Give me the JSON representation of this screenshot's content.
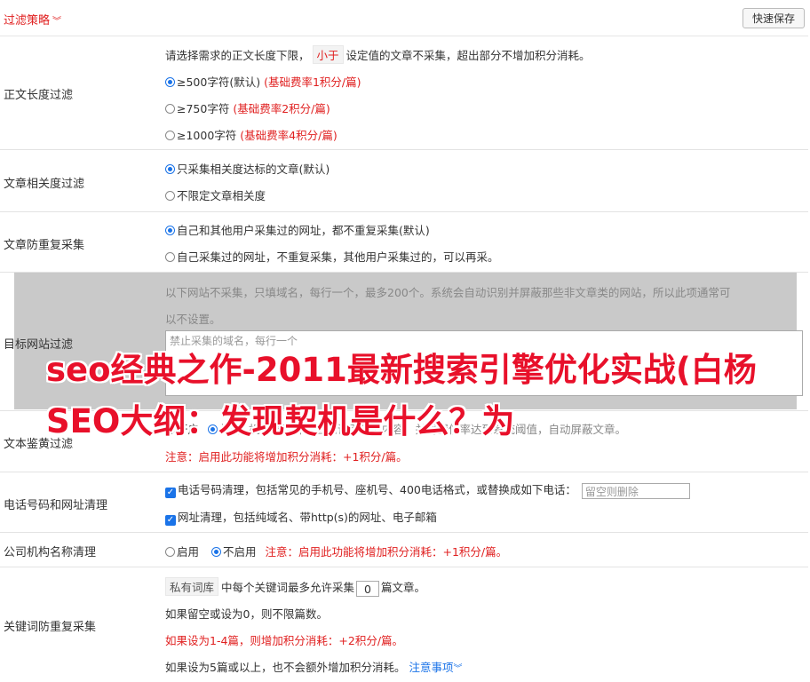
{
  "header": {
    "filter_title": "过滤策略",
    "quick_save": "快速保存"
  },
  "length_filter": {
    "label": "正文长度过滤",
    "desc_pre": "请选择需求的正文长度下限，",
    "desc_tag": "小于",
    "desc_post": "设定值的文章不采集，超出部分不增加积分消耗。",
    "options": [
      {
        "label": "≥500字符(默认)",
        "note": "(基础费率1积分/篇)"
      },
      {
        "label": "≥750字符",
        "note": "(基础费率2积分/篇)"
      },
      {
        "label": "≥1000字符",
        "note": "(基础费率4积分/篇)"
      }
    ]
  },
  "relevance_filter": {
    "label": "文章相关度过滤",
    "options": [
      "只采集相关度达标的文章(默认)",
      "不限定文章相关度"
    ]
  },
  "dedupe": {
    "label": "文章防重复采集",
    "options": [
      "自己和其他用户采集过的网址，都不重复采集(默认)",
      "自己采集过的网址，不重复采集，其他用户采集过的，可以再采。"
    ]
  },
  "target_site": {
    "label": "目标网站过滤",
    "desc_line1": "以下网站不采集，只填域名，每行一个，最多200个。系统会自动识别并屏蔽那些非文章类的网站，所以此项通常可",
    "desc_line2": "以不设置。",
    "placeholder": "禁止采集的域名，每行一个"
  },
  "text_check": {
    "label": "文本鉴黄过滤",
    "opt_on": "开启",
    "opt_off": "关闭",
    "desc": "机器学习算法自动识别色情内容，并将置信率达到系统阈值，自动屏蔽文章。",
    "note": "注意：启用此功能将增加积分消耗：+1积分/篇。"
  },
  "phone_clean": {
    "label": "电话号码和网址清理",
    "phone_desc": "电话号码清理，包括常见的手机号、座机号、400电话格式，或替换成如下电话：",
    "phone_placeholder": "留空则删除",
    "url_desc": "网址清理，包括纯域名、带http(s)的网址、电子邮箱"
  },
  "org_clean": {
    "label": "公司机构名称清理",
    "opt_on": "启用",
    "opt_off": "不启用",
    "note": "注意：启用此功能将增加积分消耗：+1积分/篇。"
  },
  "keyword_dedupe": {
    "label": "关键词防重复采集",
    "tag": "私有词库",
    "desc_pre": "中每个关键词最多允许采集",
    "count": "0",
    "desc_post": "篇文章。",
    "line2": "如果留空或设为0，则不限篇数。",
    "line3": "如果设为1-4篇，则增加积分消耗：+2积分/篇。",
    "line4": "如果设为5篇或以上，也不会额外增加积分消耗。",
    "notice_link": "注意事项"
  },
  "overlay_title": "seo经典之作-2011最新搜索引擎优化实战(白杨SEO大纲：发现契机是什么？为"
}
